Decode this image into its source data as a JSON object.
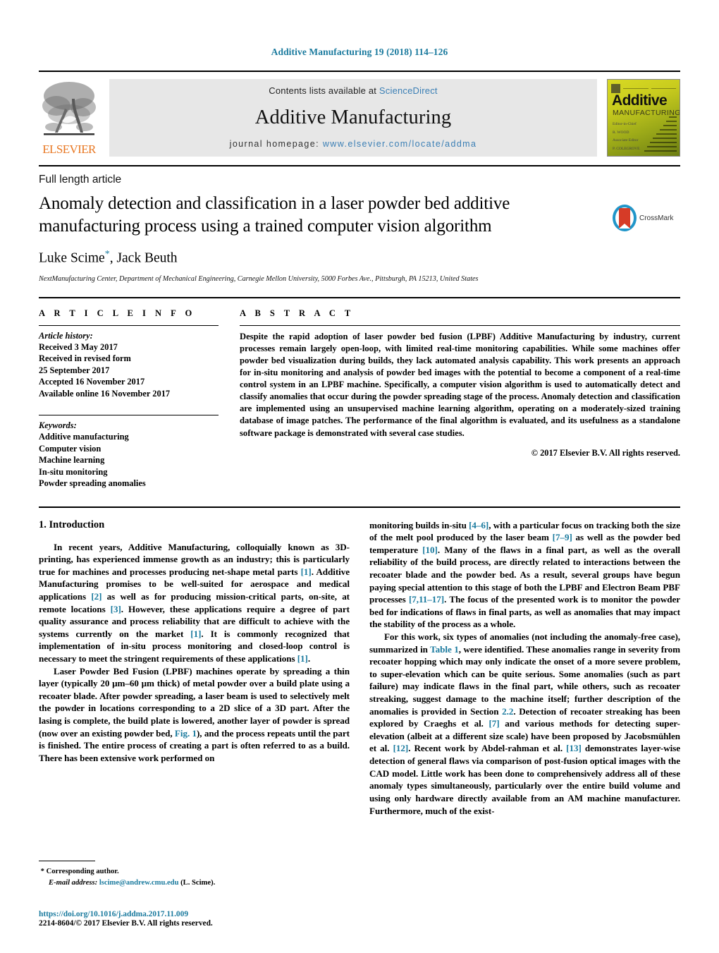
{
  "running_head": "Additive Manufacturing 19 (2018) 114–126",
  "masthead": {
    "publisher_logo_label": "ELSEVIER",
    "contents_prefix": "Contents lists available at",
    "contents_link": "ScienceDirect",
    "journal_title": "Additive Manufacturing",
    "homepage_prefix": "journal homepage:",
    "homepage_url": "www.elsevier.com/locate/addma",
    "cover": {
      "line1": "Additive",
      "line2": "MANUFACTURING",
      "meta1": "Editor-in-Chief",
      "meta2": "R. WOOD",
      "meta3": "Associate Editor",
      "meta4": "P. COLEGROVE"
    }
  },
  "article": {
    "category": "Full length article",
    "title": "Anomaly detection and classification in a laser powder bed additive manufacturing process using a trained computer vision algorithm",
    "authors": "Luke Scime",
    "authors_rest": ", Jack Beuth",
    "corresponding_marker": "*",
    "affiliation": "NextManufacturing Center, Department of Mechanical Engineering, Carnegie Mellon University, 5000 Forbes Ave., Pittsburgh, PA 15213, United States",
    "crossmark_label": "CrossMark"
  },
  "info": {
    "heading": "A R T I C L E  I N F O",
    "history_label": "Article history:",
    "history": [
      "Received 3 May 2017",
      "Received in revised form",
      "25 September 2017",
      "Accepted 16 November 2017",
      "Available online 16 November 2017"
    ],
    "keywords_label": "Keywords:",
    "keywords": [
      "Additive manufacturing",
      "Computer vision",
      "Machine learning",
      "In-situ monitoring",
      "Powder spreading anomalies"
    ]
  },
  "abstract": {
    "heading": "A B S T R A C T",
    "text": "Despite the rapid adoption of laser powder bed fusion (LPBF) Additive Manufacturing by industry, current processes remain largely open-loop, with limited real-time monitoring capabilities. While some machines offer powder bed visualization during builds, they lack automated analysis capability. This work presents an approach for in-situ monitoring and analysis of powder bed images with the potential to become a component of a real-time control system in an LPBF machine. Specifically, a computer vision algorithm is used to automatically detect and classify anomalies that occur during the powder spreading stage of the process. Anomaly detection and classification are implemented using an unsupervised machine learning algorithm, operating on a moderately-sized training database of image patches. The performance of the final algorithm is evaluated, and its usefulness as a standalone software package is demonstrated with several case studies.",
    "copyright": "© 2017 Elsevier B.V. All rights reserved."
  },
  "body": {
    "section_title": "1. Introduction",
    "col1_para1_a": "In recent years, Additive Manufacturing, colloquially known as 3D-printing, has experienced immense growth as an industry; this is particularly true for machines and processes producing net-shape metal parts ",
    "col1_ref1": "[1]",
    "col1_para1_b": ". Additive Manufacturing promises to be well-suited for aerospace and medical applications ",
    "col1_ref2": "[2]",
    "col1_para1_c": " as well as for producing mission-critical parts, on-site, at remote locations ",
    "col1_ref3": "[3]",
    "col1_para1_d": ". However, these applications require a degree of part quality assurance and process reliability that are difficult to achieve with the systems currently on the market ",
    "col1_ref4": "[1]",
    "col1_para1_e": ". It is commonly recognized that implementation of in-situ process monitoring and closed-loop control is necessary to meet the stringent requirements of these applications ",
    "col1_ref5": "[1]",
    "col1_para1_f": ".",
    "col1_para2_a": "Laser Powder Bed Fusion (LPBF) machines operate by spreading a thin layer (typically 20 μm–60 μm thick) of metal powder over a build plate using a recoater blade. After powder spreading, a laser beam is used to selectively melt the powder in locations corresponding to a 2D slice of a 3D part. After the lasing is complete, the build plate is lowered, another layer of powder is spread (now over an existing powder bed, ",
    "col1_ref6": "Fig. 1",
    "col1_para2_b": "), and the process repeats until the part is finished. The entire process of creating a part is often referred to as a build. There has been extensive work performed on",
    "col2_para1_a": "monitoring builds in-situ ",
    "col2_ref1": "[4–6]",
    "col2_para1_b": ", with a particular focus on tracking both the size of the melt pool produced by the laser beam ",
    "col2_ref2": "[7–9]",
    "col2_para1_c": " as well as the powder bed temperature ",
    "col2_ref3": "[10]",
    "col2_para1_d": ". Many of the flaws in a final part, as well as the overall reliability of the build process, are directly related to interactions between the recoater blade and the powder bed. As a result, several groups have begun paying special attention to this stage of both the LPBF and Electron Beam PBF processes ",
    "col2_ref4": "[7,11–17]",
    "col2_para1_e": ". The focus of the presented work is to monitor the powder bed for indications of flaws in final parts, as well as anomalies that may impact the stability of the process as a whole.",
    "col2_para2_a": "For this work, six types of anomalies (not including the anomaly-free case), summarized in ",
    "col2_ref5": "Table 1",
    "col2_para2_b": ", were identified. These anomalies range in severity from recoater hopping which may only indicate the onset of a more severe problem, to super-elevation which can be quite serious. Some anomalies (such as part failure) may indicate flaws in the final part, while others, such as recoater streaking, suggest damage to the machine itself; further description of the anomalies is provided in Section ",
    "col2_ref6": "2.2",
    "col2_para2_c": ". Detection of recoater streaking has been explored by Craeghs et al. ",
    "col2_ref7": "[7]",
    "col2_para2_d": " and various methods for detecting super-elevation (albeit at a different size scale) have been proposed by Jacobsmühlen et al. ",
    "col2_ref8": "[12]",
    "col2_para2_e": ". Recent work by Abdel-rahman et al. ",
    "col2_ref9": "[13]",
    "col2_para2_f": " demonstrates layer-wise detection of general flaws via comparison of post-fusion optical images with the CAD model. Little work has been done to comprehensively address all of these anomaly types simultaneously, particularly over the entire build volume and using only hardware directly available from an AM machine manufacturer. Furthermore, much of the exist-"
  },
  "footer": {
    "corresponding_marker": "*",
    "corresponding_label": "Corresponding author.",
    "email_label": "E-mail address:",
    "email": "lscime@andrew.cmu.edu",
    "email_suffix": "(L. Scime).",
    "doi": "https://doi.org/10.1016/j.addma.2017.11.009",
    "issn_line": "2214-8604/© 2017 Elsevier B.V. All rights reserved."
  },
  "colors": {
    "link": "#1a7a9e",
    "sciencedirect": "#3b7fb5",
    "elsevier_orange": "#E87722",
    "banner_bg": "#e7e7e7",
    "crossmark_blue": "#2196c9",
    "crossmark_red": "#d63b27"
  }
}
